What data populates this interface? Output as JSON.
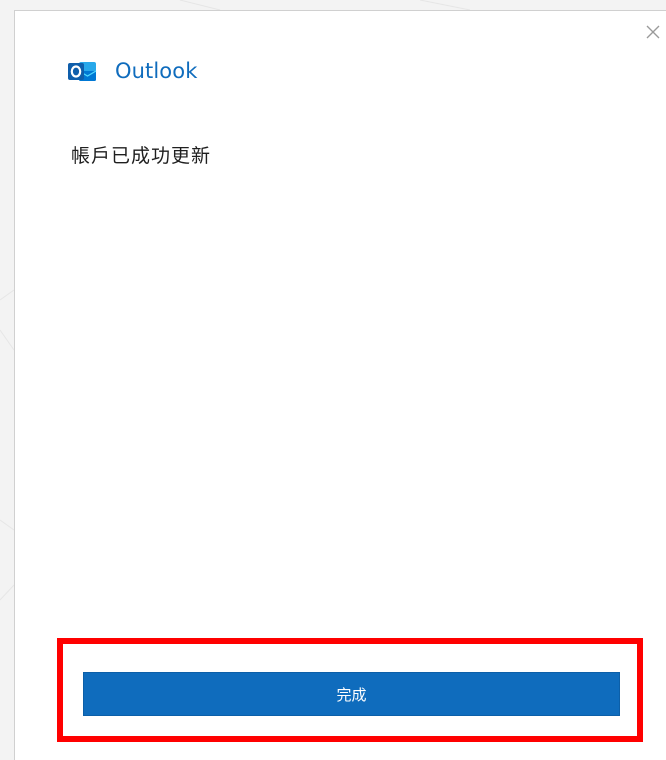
{
  "dialog": {
    "app_name": "Outlook",
    "message": "帳戶已成功更新",
    "done_label": "完成",
    "close_icon": "close-icon",
    "brand_icon": "outlook-icon"
  },
  "colors": {
    "brand_blue": "#0f6cbd",
    "highlight_red": "#ff0000",
    "text": "#1f1f1f"
  }
}
